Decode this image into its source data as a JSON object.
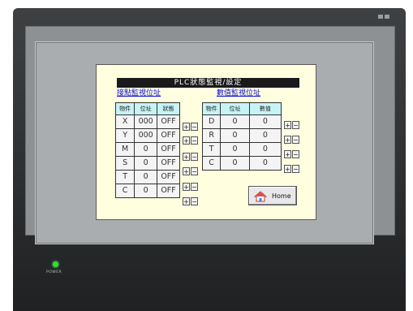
{
  "device": {
    "power_label": "POWER",
    "led_color": "#30e030"
  },
  "screen": {
    "title": "PLC狀態監視/設定",
    "contact_section_title": "接點監視位址",
    "value_section_title": "數值監視位址",
    "contact_table": {
      "headers": [
        "物件",
        "位址",
        "狀態"
      ],
      "rows": [
        {
          "name": "X",
          "address": "000",
          "state": "OFF"
        },
        {
          "name": "Y",
          "address": "000",
          "state": "OFF"
        },
        {
          "name": "M",
          "address": "0",
          "state": "OFF"
        },
        {
          "name": "S",
          "address": "0",
          "state": "OFF"
        },
        {
          "name": "T",
          "address": "0",
          "state": "OFF"
        },
        {
          "name": "C",
          "address": "0",
          "state": "OFF"
        }
      ]
    },
    "value_table": {
      "headers": [
        "物件",
        "位址",
        "數值"
      ],
      "rows": [
        {
          "name": "D",
          "address": "0",
          "value": "0"
        },
        {
          "name": "R",
          "address": "0",
          "value": "0"
        },
        {
          "name": "T",
          "address": "0",
          "value": "0"
        },
        {
          "name": "C",
          "address": "0",
          "value": "0"
        }
      ]
    },
    "plus_label": "+",
    "minus_label": "−",
    "home_button_label": "Home",
    "home_icon": "home-icon",
    "header_cell_color": "#c6f3f6",
    "background_color": "#ffffe0"
  }
}
